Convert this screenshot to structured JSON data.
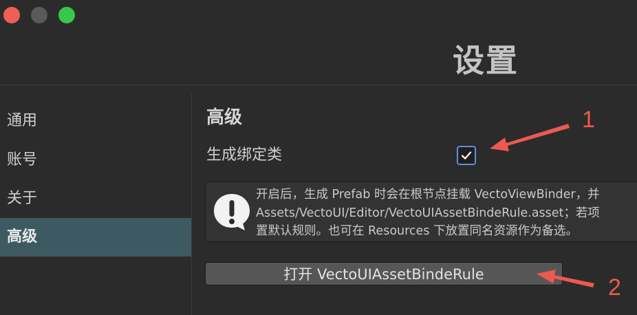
{
  "window": {
    "title": "设置"
  },
  "sidebar": {
    "items": [
      {
        "label": "通用",
        "active": false
      },
      {
        "label": "账号",
        "active": false
      },
      {
        "label": "关于",
        "active": false
      },
      {
        "label": "高级",
        "active": true
      }
    ]
  },
  "main": {
    "section_title": "高级",
    "option": {
      "label": "生成绑定类",
      "checked": true
    },
    "info": {
      "icon": "exclamation-bubble-icon",
      "lines": [
        "开启后，生成 Prefab 时会在根节点挂载 VectoViewBinder，并",
        "Assets/VectoUI/Editor/VectoUIAssetBindeRule.asset；若项",
        "置默认规则。也可在 Resources 下放置同名资源作为备选。"
      ]
    },
    "open_button_label": "打开 VectoUIAssetBindeRule"
  },
  "annotations": {
    "marker_1": "1",
    "marker_2": "2",
    "color": "#ec5a4f"
  },
  "colors": {
    "background": "#2b2b2b",
    "sidebar_active": "#3d5a63",
    "checkbox_border": "#5f8fe0",
    "traffic_close": "#ee5f57",
    "traffic_min": "#5a5a5a",
    "traffic_max": "#37c849"
  }
}
